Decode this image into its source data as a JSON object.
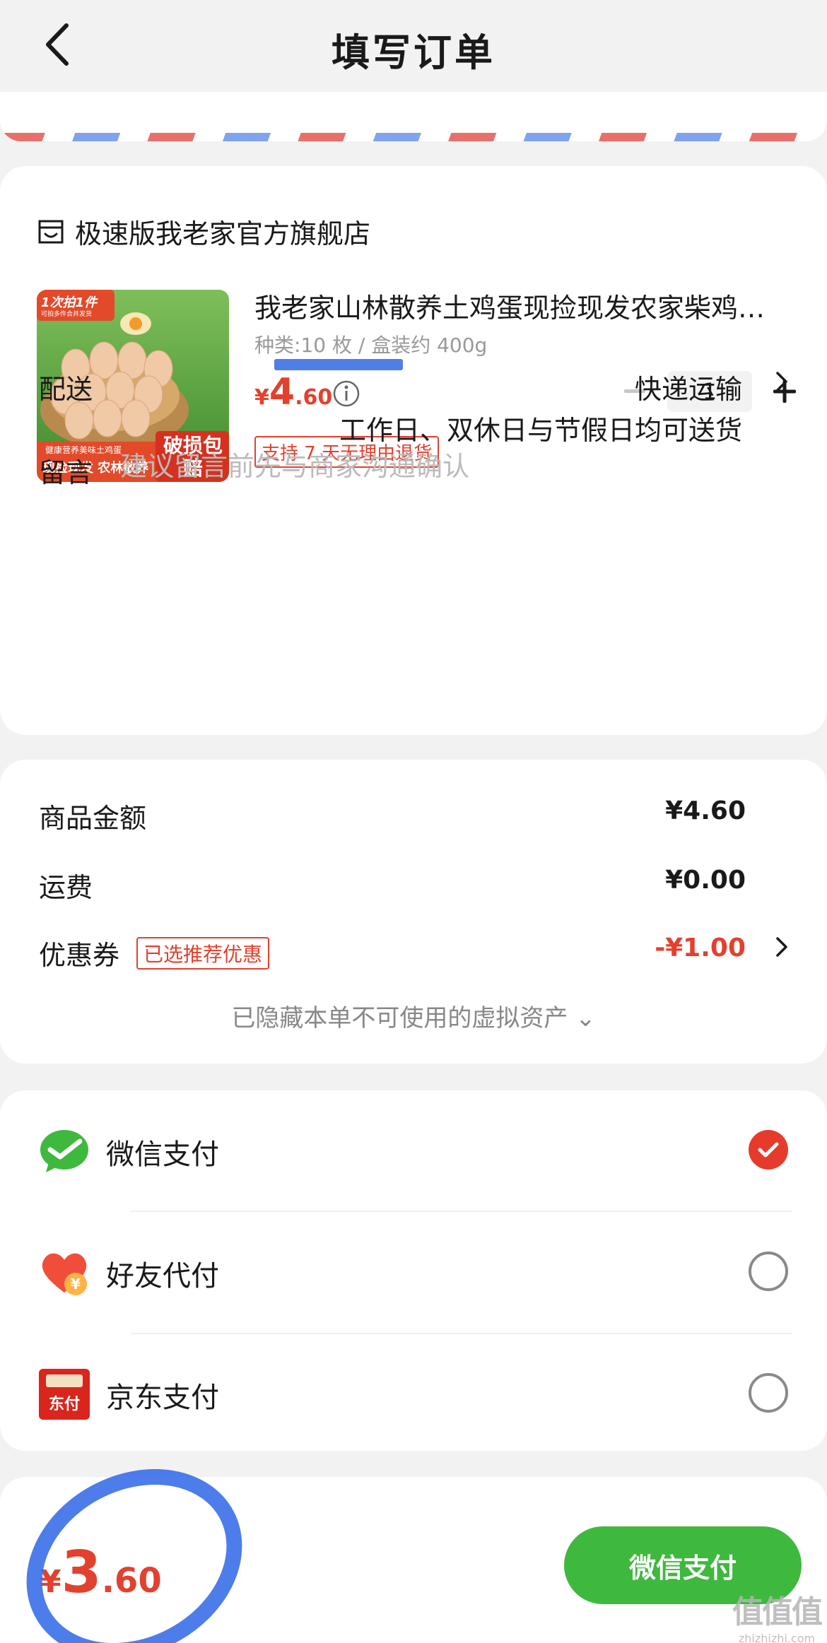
{
  "header": {
    "title": "填写订单"
  },
  "shop": {
    "name": "极速版我老家官方旗舰店"
  },
  "product": {
    "title": "我老家山林散养土鸡蛋现捡现发农家柴鸡蛋新鲜",
    "spec": "种类:10 枚 / 盒装约 400g",
    "price_symbol": "¥",
    "price_int": "4",
    "price_dec": ".60",
    "quantity": "1",
    "return_policy": "支持 7 天无理由退货",
    "image": {
      "badge_top": "1次拍1件",
      "badge_sub": "可拍多件合并发货",
      "banner_small": "健康营养美味土鸡蛋",
      "banner_main": "现捡现发 农林散养",
      "guarantee": "破损包赔"
    }
  },
  "delivery": {
    "label": "配送",
    "method": "快递运输",
    "note": "工作日、双休日与节假日均可送货"
  },
  "message": {
    "label": "留言",
    "placeholder": "建议留言前先与商家沟通确认"
  },
  "summary": {
    "goods_label": "商品金额",
    "goods_value": "¥4.60",
    "shipping_label": "运费",
    "shipping_value": "¥0.00",
    "coupon_label": "优惠券",
    "coupon_tag": "已选推荐优惠",
    "coupon_value": "-¥1.00",
    "hidden_assets": "已隐藏本单不可使用的虚拟资产 ⌄"
  },
  "payment": {
    "options": [
      {
        "label": "微信支付",
        "icon": "wechat-pay-icon",
        "selected": true
      },
      {
        "label": "好友代付",
        "icon": "friend-pay-icon",
        "selected": false
      },
      {
        "label": "京东支付",
        "icon": "jd-pay-icon",
        "selected": false,
        "icon_text": "东付"
      }
    ]
  },
  "footer": {
    "total_symbol": "¥",
    "total_int": "3",
    "total_dec": ".60",
    "pay_button": "微信支付"
  },
  "watermark": {
    "main": "值值值",
    "sub": "zhizhizhi.com"
  },
  "colors": {
    "accent_red": "#e2412e",
    "wechat_green": "#3fb83e",
    "background": "#f2f2f2",
    "annotation_blue": "#3a6fe8"
  }
}
